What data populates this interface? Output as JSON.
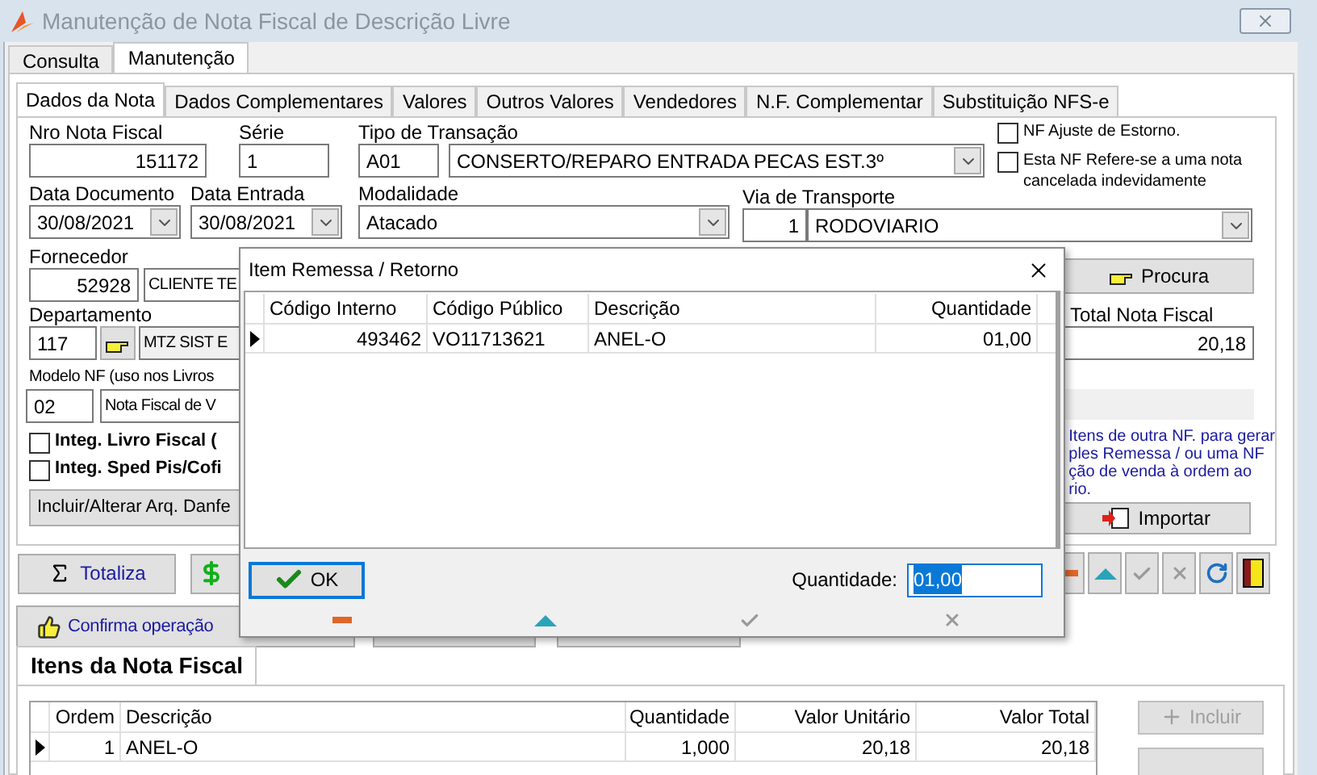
{
  "window": {
    "title": "Manutenção de Nota Fiscal de Descrição Livre"
  },
  "main_tabs": [
    {
      "label": "Consulta",
      "selected": false
    },
    {
      "label": "Manutenção",
      "selected": true
    }
  ],
  "form_tabs": [
    {
      "label": "Dados da Nota",
      "selected": true
    },
    {
      "label": "Dados Complementares",
      "selected": false
    },
    {
      "label": "Valores",
      "selected": false
    },
    {
      "label": "Outros Valores",
      "selected": false
    },
    {
      "label": "Vendedores",
      "selected": false
    },
    {
      "label": "N.F. Complementar",
      "selected": false
    },
    {
      "label": "Substituição NFS-e",
      "selected": false
    }
  ],
  "form": {
    "nro_nota_fiscal": {
      "label": "Nro Nota Fiscal",
      "value": "151172"
    },
    "serie": {
      "label": "Série",
      "value": "1"
    },
    "tipo_transacao": {
      "label": "Tipo de Transação",
      "code": "A01",
      "value": "CONSERTO/REPARO ENTRADA PECAS EST.3º"
    },
    "top_checkboxes": [
      {
        "label": "NF Ajuste de Estorno.",
        "checked": false
      },
      {
        "label": "Esta NF Refere-se a uma nota cancelada indevidamente",
        "checked": false
      }
    ],
    "data_documento": {
      "label": "Data Documento",
      "value": "30/08/2021"
    },
    "data_entrada": {
      "label": "Data Entrada",
      "value": "30/08/2021"
    },
    "modalidade": {
      "label": "Modalidade",
      "value": "Atacado"
    },
    "via_transporte": {
      "label": "Via de Transporte",
      "code": "1",
      "value": "RODOVIARIO"
    },
    "fornecedor": {
      "label": "Fornecedor",
      "code": "52928",
      "value": "CLIENTE TE"
    },
    "procura_button": "Procura",
    "departamento": {
      "label": "Departamento",
      "code": "117",
      "value": "MTZ SIST E"
    },
    "total_nota_fiscal": {
      "label": "Total Nota Fiscal",
      "value": "20,18"
    },
    "modelo_nf": {
      "label": "Modelo NF (uso nos Livros",
      "code": "02",
      "value": "Nota Fiscal de V"
    },
    "integ_checkboxes": [
      {
        "label": "Integ. Livro Fiscal (",
        "checked": false
      },
      {
        "label": "Integ. Sped Pis/Cofi",
        "checked": false
      }
    ],
    "danfe_button": "Incluir/Alterar Arq. Danfe",
    "import_note": [
      "Itens de outra NF. para gerar",
      "ples Remessa / ou uma NF",
      "ção de venda à ordem ao",
      "rio."
    ],
    "importar_button": "Importar"
  },
  "actions": {
    "totaliza_button": "Totaliza",
    "confirma_button": "Confirma operação"
  },
  "toolbar": [
    {
      "kind": "minus",
      "disabled": false
    },
    {
      "kind": "up",
      "disabled": false
    },
    {
      "kind": "check",
      "disabled": true
    },
    {
      "kind": "cancel",
      "disabled": true
    },
    {
      "kind": "refresh",
      "disabled": false
    },
    {
      "kind": "exit",
      "disabled": false
    }
  ],
  "items_tab": {
    "label": "Itens da Nota Fiscal",
    "selected": true
  },
  "items_table": {
    "columns": [
      "Ordem",
      "Descrição",
      "Quantidade",
      "Valor Unitário",
      "Valor Total"
    ],
    "rows": [
      {
        "cells": [
          "1",
          "ANEL-O",
          "1,000",
          "20,18",
          "20,18"
        ],
        "selected": true
      }
    ]
  },
  "incluir_button": {
    "label": "Incluir",
    "disabled": true
  },
  "dialog": {
    "title": "Item Remessa / Retorno",
    "columns": [
      "Código Interno",
      "Código Público",
      "Descrição",
      "Quantidade"
    ],
    "rows": [
      {
        "cells": [
          "493462",
          "VO11713621",
          "ANEL-O",
          "01,00"
        ],
        "selected": true
      }
    ],
    "ok_button": "OK",
    "quantity_label": "Quantidade:",
    "quantity_value": "01,00",
    "nav": [
      {
        "kind": "minus",
        "disabled": false
      },
      {
        "kind": "up",
        "disabled": false
      },
      {
        "kind": "check",
        "disabled": true
      },
      {
        "kind": "cancel",
        "disabled": true
      }
    ]
  }
}
